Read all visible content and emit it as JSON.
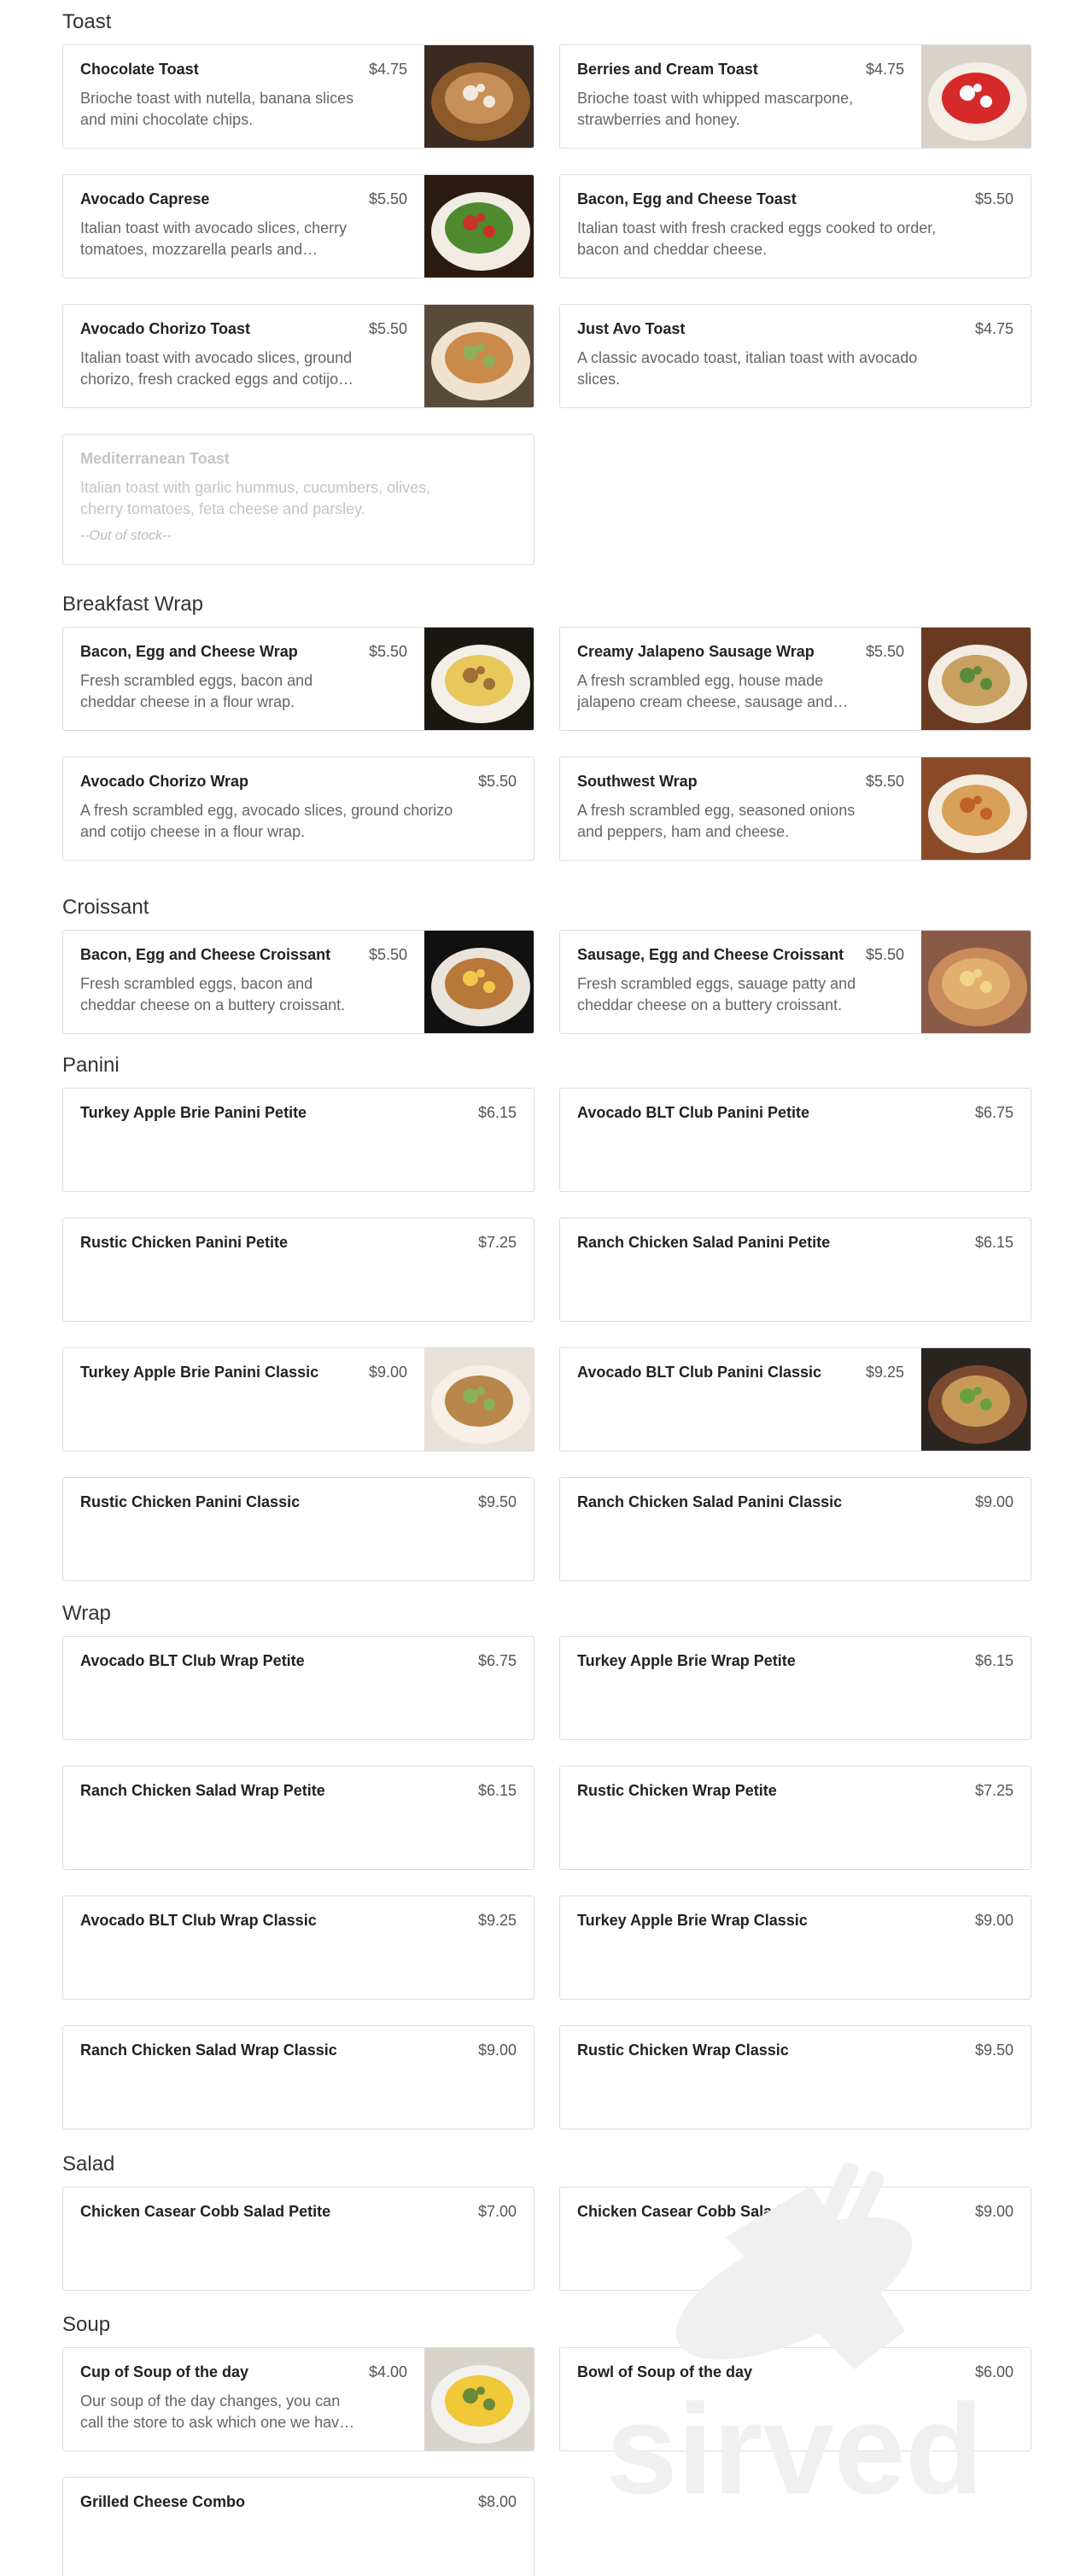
{
  "sections": [
    {
      "title": "Toast",
      "items": [
        {
          "name": "Chocolate Toast",
          "price": "$4.75",
          "desc": "Brioche toast with nutella, banana slices and mini chocolate chips.",
          "image": "chocolate-toast-photo"
        },
        {
          "name": "Berries and Cream Toast",
          "price": "$4.75",
          "desc": "Brioche toast with whipped mascarpone, strawberries and honey.",
          "image": "berries-cream-toast-photo"
        },
        {
          "name": "Avocado Caprese",
          "price": "$5.50",
          "desc": "Italian toast with avocado slices, cherry tomatoes, mozzarella pearls and balsamic glaze.",
          "image": "avocado-caprese-photo"
        },
        {
          "name": "Bacon, Egg and Cheese Toast",
          "price": "$5.50",
          "desc": "Italian toast with fresh cracked eggs cooked to order, bacon and cheddar cheese."
        },
        {
          "name": "Avocado Chorizo Toast",
          "price": "$5.50",
          "desc": "Italian toast with avocado slices, ground chorizo, fresh cracked eggs and cotijo cheese.",
          "image": "avocado-chorizo-toast-photo"
        },
        {
          "name": "Just Avo Toast",
          "price": "$4.75",
          "desc": "A classic avocado toast, italian toast with avocado slices."
        },
        {
          "name": "Mediterranean Toast",
          "price": "",
          "desc": "Italian toast with garlic hummus, cucumbers, olives, cherry tomatoes, feta cheese and parsley.",
          "stock": "--Out of stock--",
          "out": true
        }
      ]
    },
    {
      "title": "Breakfast Wrap",
      "items": [
        {
          "name": "Bacon, Egg and Cheese Wrap",
          "price": "$5.50",
          "desc": "Fresh scrambled eggs, bacon and cheddar cheese in a flour wrap.",
          "image": "bacon-egg-cheese-wrap-photo"
        },
        {
          "name": "Creamy Jalapeno Sausage Wrap",
          "price": "$5.50",
          "desc": "A fresh scrambled egg, house made jalapeno cream cheese, sausage and cheddar.",
          "image": "jalapeno-sausage-wrap-photo"
        },
        {
          "name": "Avocado Chorizo Wrap",
          "price": "$5.50",
          "desc": "A fresh scrambled egg, avocado slices, ground chorizo and cotijo cheese in a flour wrap."
        },
        {
          "name": "Southwest Wrap",
          "price": "$5.50",
          "desc": "A fresh scrambled egg, seasoned onions and peppers, ham and cheese.",
          "image": "southwest-wrap-photo"
        }
      ]
    },
    {
      "title": "Croissant",
      "items": [
        {
          "name": "Bacon, Egg and Cheese Croissant",
          "price": "$5.50",
          "desc": "Fresh scrambled eggs, bacon and cheddar cheese on a buttery croissant.",
          "image": "bacon-croissant-photo"
        },
        {
          "name": "Sausage, Egg and Cheese Croissant",
          "price": "$5.50",
          "desc": "Fresh scrambled eggs, sauage patty and cheddar cheese on a buttery croissant.",
          "image": "sausage-croissant-photo"
        }
      ]
    },
    {
      "title": "Panini",
      "items": [
        {
          "name": "Turkey Apple Brie Panini Petite",
          "price": "$6.15"
        },
        {
          "name": "Avocado BLT Club Panini Petite",
          "price": "$6.75"
        },
        {
          "name": "Rustic Chicken Panini Petite",
          "price": "$7.25"
        },
        {
          "name": "Ranch Chicken Salad Panini Petite",
          "price": "$6.15"
        },
        {
          "name": "Turkey Apple Brie Panini Classic",
          "price": "$9.00",
          "image": "turkey-panini-photo"
        },
        {
          "name": "Avocado BLT Club Panini Classic",
          "price": "$9.25",
          "image": "blt-panini-photo"
        },
        {
          "name": "Rustic Chicken Panini Classic",
          "price": "$9.50"
        },
        {
          "name": "Ranch Chicken Salad Panini Classic",
          "price": "$9.00"
        }
      ]
    },
    {
      "title": "Wrap",
      "items": [
        {
          "name": "Avocado BLT Club Wrap Petite",
          "price": "$6.75"
        },
        {
          "name": "Turkey Apple Brie Wrap Petite",
          "price": "$6.15"
        },
        {
          "name": "Ranch Chicken Salad Wrap Petite",
          "price": "$6.15"
        },
        {
          "name": "Rustic Chicken Wrap Petite",
          "price": "$7.25"
        },
        {
          "name": "Avocado BLT Club Wrap Classic",
          "price": "$9.25"
        },
        {
          "name": "Turkey Apple Brie Wrap Classic",
          "price": "$9.00"
        },
        {
          "name": "Ranch Chicken Salad Wrap Classic",
          "price": "$9.00"
        },
        {
          "name": "Rustic Chicken Wrap Classic",
          "price": "$9.50"
        }
      ]
    },
    {
      "title": "Salad",
      "items": [
        {
          "name": "Chicken Casear Cobb Salad Petite",
          "price": "$7.00"
        },
        {
          "name": "Chicken Casear Cobb Salad Classic",
          "price": "$9.00"
        }
      ]
    },
    {
      "title": "Soup",
      "items": [
        {
          "name": "Cup of Soup of the day",
          "price": "$4.00",
          "desc": "Our soup of the day changes, you can call the store to ask which one we have today.",
          "image": "soup-photo"
        },
        {
          "name": "Bowl of Soup of the day",
          "price": "$6.00"
        },
        {
          "name": "Grilled Cheese Combo",
          "price": "$8.00"
        }
      ]
    }
  ],
  "watermark": "sirved",
  "colors": {
    "border": "#dcdcdc",
    "text": "#222222",
    "muted": "#666666",
    "out_of_stock": "#c4c4c4"
  }
}
